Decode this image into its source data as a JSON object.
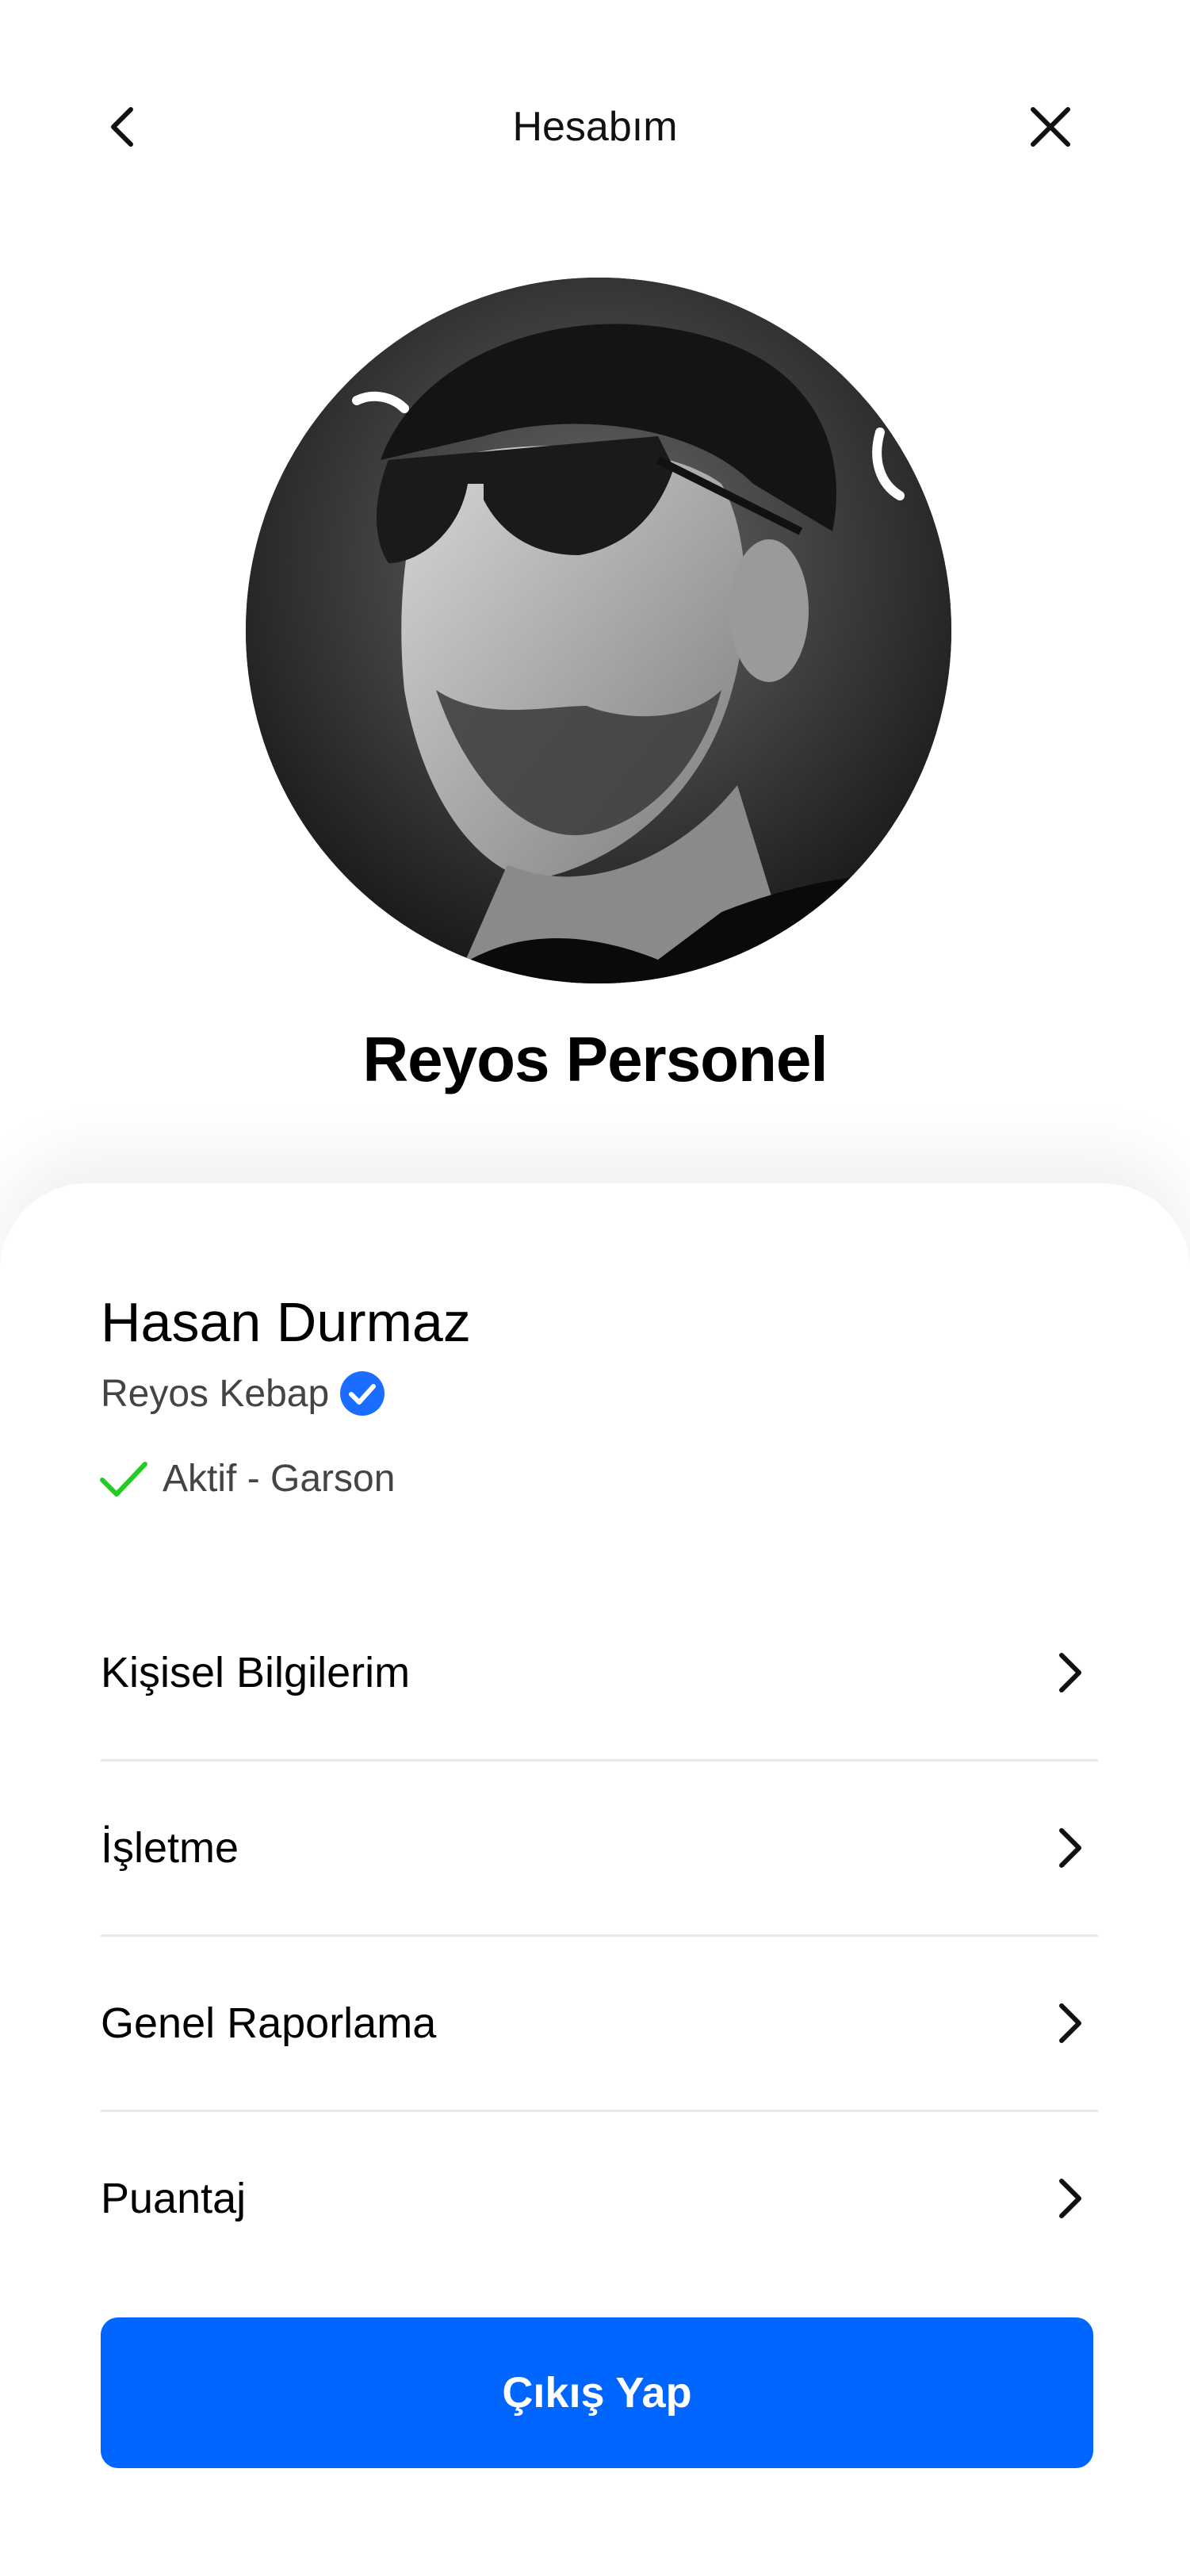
{
  "header": {
    "title": "Hesabım",
    "back_icon": "chevron-left-icon",
    "close_icon": "close-icon"
  },
  "profile": {
    "display_name": "Reyos Personel",
    "avatar": "user-photo"
  },
  "user": {
    "full_name": "Hasan Durmaz",
    "business": "Reyos Kebap",
    "verified_icon": "verified-badge-icon",
    "status": "Aktif - Garson",
    "status_icon": "check-icon"
  },
  "menu": {
    "items": [
      {
        "label": "Kişisel Bilgilerim"
      },
      {
        "label": "İşletme"
      },
      {
        "label": "Genel Raporlama"
      },
      {
        "label": "Puantaj"
      }
    ]
  },
  "actions": {
    "logout_label": "Çıkış Yap"
  },
  "colors": {
    "accent": "#0066ff",
    "verified": "#1a6dff",
    "status_check": "#22cc22",
    "divider": "#e8e8e8"
  }
}
